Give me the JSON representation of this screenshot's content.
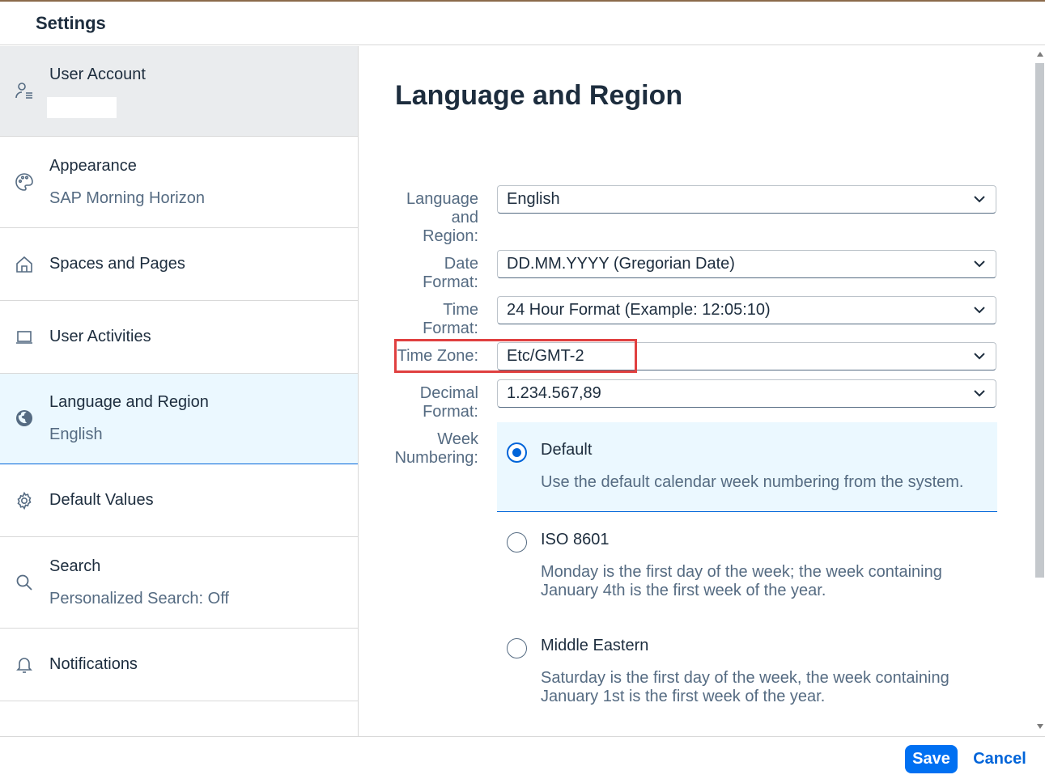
{
  "header": {
    "title": "Settings"
  },
  "sidebar": {
    "items": [
      {
        "label": "User Account",
        "sub": "",
        "icon": "user-settings-icon"
      },
      {
        "label": "Appearance",
        "sub": "SAP Morning Horizon",
        "icon": "palette-icon"
      },
      {
        "label": "Spaces and Pages",
        "sub": "",
        "icon": "home-icon"
      },
      {
        "label": "User Activities",
        "sub": "",
        "icon": "laptop-icon"
      },
      {
        "label": "Language and Region",
        "sub": "English",
        "icon": "globe-icon"
      },
      {
        "label": "Default Values",
        "sub": "",
        "icon": "gear-icon"
      },
      {
        "label": "Search",
        "sub": "Personalized Search: Off",
        "icon": "search-icon"
      },
      {
        "label": "Notifications",
        "sub": "",
        "icon": "bell-icon"
      }
    ]
  },
  "main": {
    "title": "Language and Region",
    "fields": {
      "language": {
        "label": "Language and Region:",
        "value": "English"
      },
      "date_format": {
        "label": "Date Format:",
        "value": "DD.MM.YYYY (Gregorian Date)"
      },
      "time_format": {
        "label": "Time Format:",
        "value": "24 Hour Format (Example: 12:05:10)"
      },
      "time_zone": {
        "label": "Time Zone:",
        "value": "Etc/GMT-2"
      },
      "decimal_format": {
        "label": "Decimal Format:",
        "value": "1.234.567,89"
      },
      "week_numbering": {
        "label": "Week Numbering:",
        "options": [
          {
            "title": "Default",
            "desc": "Use the default calendar week numbering from the system.",
            "selected": true
          },
          {
            "title": "ISO 8601",
            "desc": "Monday is the first day of the week; the week containing January 4th is the first week of the year.",
            "selected": false
          },
          {
            "title": "Middle Eastern",
            "desc": "Saturday is the first day of the week, the week containing January 1st is the first week of the year.",
            "selected": false
          }
        ]
      }
    }
  },
  "footer": {
    "save_label": "Save",
    "cancel_label": "Cancel"
  },
  "colors": {
    "accent": "#0070f2",
    "highlight": "#e04040",
    "selected_bg": "#ebf8ff"
  }
}
